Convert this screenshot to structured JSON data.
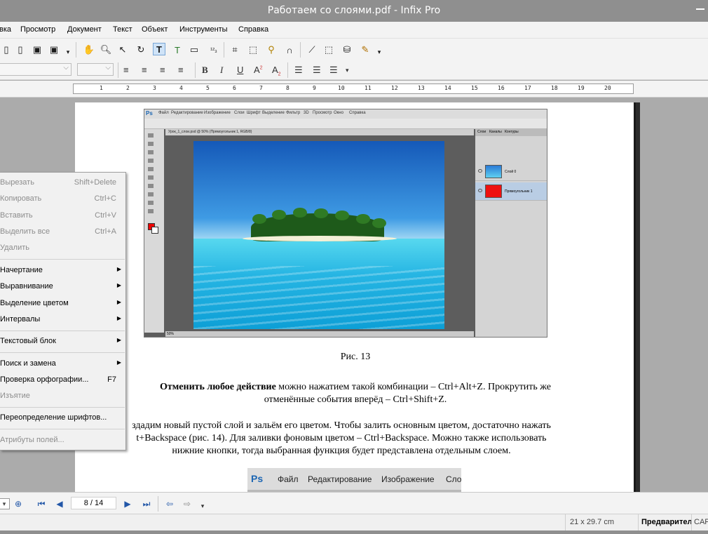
{
  "window": {
    "title": "Работаем со слоями.pdf - Infix Pro"
  },
  "menubar": {
    "items": [
      "вка",
      "Просмотр",
      "Документ",
      "Текст",
      "Объект",
      "Инструменты",
      "Справка"
    ]
  },
  "ruler": {
    "labels": [
      "1",
      "2",
      "3",
      "4",
      "5",
      "6",
      "7",
      "8",
      "9",
      "10",
      "11",
      "12",
      "13",
      "14",
      "15",
      "16",
      "17",
      "18",
      "19",
      "20"
    ]
  },
  "document": {
    "figure_caption": "Рис. 13",
    "para1_bold": "Отменить любое действие",
    "para1_rest": " можно нажатием такой комбинации – Ctrl+Alt+Z. Прокрутить же",
    "para1_line2": "отменённые события вперёд – Ctrl+Shift+Z.",
    "para2_line1": "здадим новый пустой слой и зальём его цветом. Чтобы залить основным цветом, достаточно нажать",
    "para2_line2": "t+Backspace (рис. 14). Для заливки фоновым цветом – Ctrl+Backspace. Можно также использовать",
    "para2_line3": "нижние кнопки, тогда выбранная функция будет представлена отдельным слоем."
  },
  "ps_screenshot": {
    "logo": "Ps",
    "menu": [
      "Файл",
      "Редактирование",
      "Изображение",
      "Слои",
      "Шрифт",
      "Выделение",
      "Фильтр",
      "3D",
      "Просмотр",
      "Окно",
      "Справка"
    ],
    "tab": "Урок_1_слои.psd @ 50% (Прямоугольник 1, RGB/8)",
    "status": "50%",
    "panel_tabs": [
      "Слои",
      "Каналы",
      "Контуры"
    ],
    "layers": [
      "Слой 0",
      "Прямоугольник 1"
    ]
  },
  "ps_screenshot2": {
    "logo": "Ps",
    "menu": [
      "Файл",
      "Редактирование",
      "Изображение",
      "Слои"
    ]
  },
  "context_menu": {
    "items": [
      {
        "label": "Вырезать",
        "shortcut": "Shift+Delete",
        "disabled": true
      },
      {
        "label": "Копировать",
        "shortcut": "Ctrl+C",
        "disabled": true
      },
      {
        "label": "Вставить",
        "shortcut": "Ctrl+V",
        "disabled": true
      },
      {
        "label": "Выделить все",
        "shortcut": "Ctrl+A",
        "disabled": true
      },
      {
        "label": "Удалить",
        "shortcut": "",
        "disabled": true
      },
      {
        "label": "Начертание",
        "shortcut": "",
        "submenu": true
      },
      {
        "label": "Выравнивание",
        "shortcut": "",
        "submenu": true
      },
      {
        "label": "Выделение цветом",
        "shortcut": "",
        "submenu": true
      },
      {
        "label": "Интервалы",
        "shortcut": "",
        "submenu": true
      },
      {
        "label": "Текстовый блок",
        "shortcut": "",
        "submenu": true
      },
      {
        "label": "Поиск и замена",
        "shortcut": "",
        "submenu": true
      },
      {
        "label": "Проверка орфографии...",
        "shortcut": "F7"
      },
      {
        "label": "Изъятие",
        "shortcut": "",
        "disabled": true
      },
      {
        "label": "Переопределение шрифтов...",
        "shortcut": ""
      },
      {
        "label": "Атрибуты полей...",
        "shortcut": "",
        "disabled": true
      }
    ]
  },
  "navigation": {
    "page_indicator": "8 / 14"
  },
  "statusbar": {
    "page_size": "21 x 29.7 cm",
    "mode": "Предварител",
    "caps": "CAP"
  },
  "colors": {
    "titlebar": "#8f8f8f",
    "background": "#ababab",
    "accent_blue": "#2257a8"
  }
}
